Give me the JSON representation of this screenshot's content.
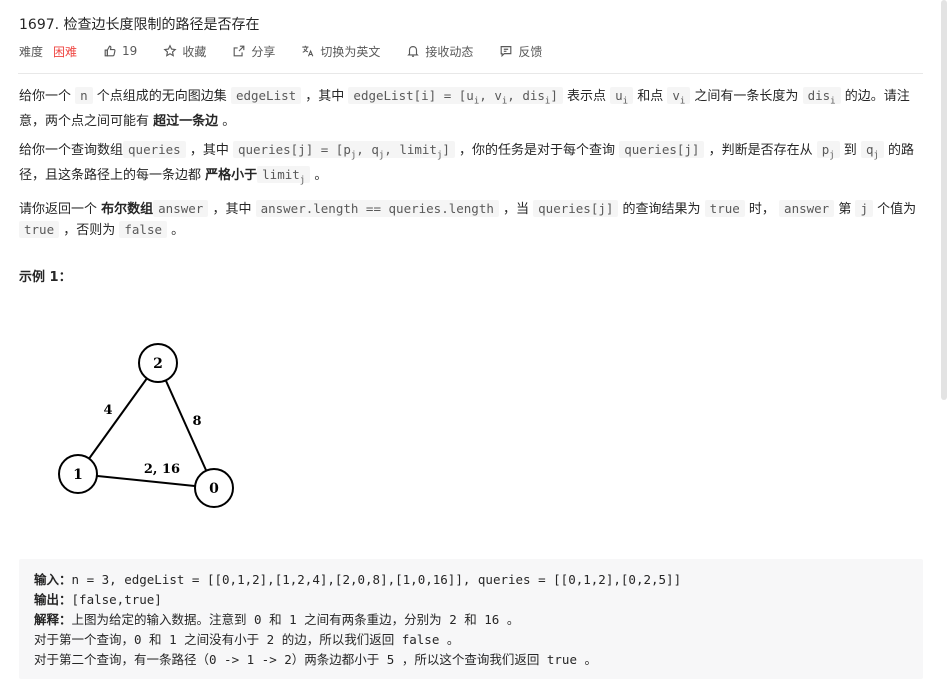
{
  "problem": {
    "title": "1697. 检查边长度限制的路径是否存在",
    "difficulty_label": "难度",
    "difficulty_value": "困难",
    "likes": "19",
    "favorite_label": "收藏",
    "share_label": "分享",
    "switch_lang_label": "切换为英文",
    "subscribe_label": "接收动态",
    "feedback_label": "反馈"
  },
  "description": {
    "p1": {
      "t1": "给你一个 ",
      "c1": "n",
      "t2": " 个点组成的无向图边集 ",
      "c2": "edgeList",
      "t3": " ，其中 ",
      "c3a": "edgeList[i] = [u",
      "c3b": ", v",
      "c3c": ", dis",
      "c3d": "]",
      "t4": " 表示点 ",
      "c4": "u",
      "t5": " 和点 ",
      "c5": "v",
      "t6": " 之间有一条长度为 ",
      "c6": "dis",
      "t7": " 的边。请注意，两个点之间可能有 ",
      "b1": "超过一条边",
      "t8": " 。",
      "sub_i": "i"
    },
    "p2": {
      "t1": "给你一个查询数组",
      "c1": "queries",
      "t2": " ，其中 ",
      "c2a": "queries[j] = [p",
      "c2b": ", q",
      "c2c": ", limit",
      "c2d": "]",
      "t3": " ，你的任务是对于每个查询 ",
      "c3": "queries[j]",
      "t4": " ，判断是否存在从 ",
      "c4": "p",
      "t5": " 到 ",
      "c5": "q",
      "t6": " 的路径，且这条路径上的每一条边都 ",
      "b1": "严格小于",
      "c6": "limit",
      "t7": " 。",
      "sub_j": "j"
    },
    "p3": {
      "t1": "请你返回一个 ",
      "b1": "布尔数组",
      "c1": "answer",
      "t2": " ，其中 ",
      "c2": "answer.length == queries.length",
      "t3": " ，当 ",
      "c3": "queries[j]",
      "t4": " 的查询结果为 ",
      "c4": "true",
      "t5": " 时， ",
      "c5": "answer",
      "t6": " 第 ",
      "c6": "j",
      "t7": " 个值为 ",
      "c7": "true",
      "t8": " ，否则为 ",
      "c8": "false",
      "t9": " 。"
    }
  },
  "example": {
    "title": "示例 1：",
    "graph": {
      "nodes": [
        "2",
        "1",
        "0"
      ],
      "edge_labels": [
        "4",
        "8",
        "2, 16"
      ]
    },
    "input_label": "输入：",
    "input_value": "n = 3, edgeList = [[0,1,2],[1,2,4],[2,0,8],[1,0,16]], queries = [[0,1,2],[0,2,5]]",
    "output_label": "输出：",
    "output_value": "[false,true]",
    "explain_label": "解释：",
    "explain_line1": "上图为给定的输入数据。注意到 0 和 1 之间有两条重边，分别为 2 和 16 。",
    "explain_line2": "对于第一个查询，0 和 1 之间没有小于 2 的边，所以我们返回 false 。",
    "explain_line3": "对于第二个查询，有一条路径（0 -> 1 -> 2）两条边都小于 5 ，所以这个查询我们返回 true 。"
  },
  "colors": {
    "difficulty_hard": "#ef4743",
    "text": "#262626",
    "muted": "#595959",
    "code_bg": "#f5f5f5",
    "example_bg": "#f7f7f8"
  },
  "icons": {
    "like": "thumbs-up-icon",
    "favorite": "star-icon",
    "share": "share-icon",
    "translate": "translate-icon",
    "subscribe": "bell-icon",
    "feedback": "message-icon"
  }
}
